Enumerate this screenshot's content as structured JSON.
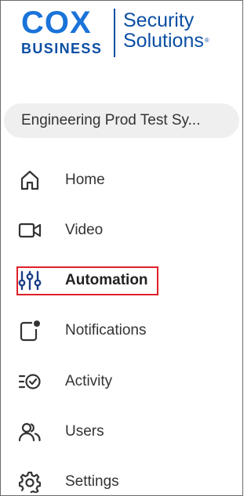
{
  "logo": {
    "brand": "COX",
    "sub": "BUSINESS",
    "product_line1": "Security",
    "product_line2": "Solutions",
    "registered_mark": "®",
    "colors": {
      "primary": "#1a73d9",
      "dark": "#0b4fa3"
    }
  },
  "site_selector": {
    "value": "Engineering Prod Test Sy..."
  },
  "nav": {
    "items": [
      {
        "label": "Home",
        "icon": "home-icon"
      },
      {
        "label": "Video",
        "icon": "video-camera-icon"
      },
      {
        "label": "Automation",
        "icon": "sliders-icon",
        "active": true
      },
      {
        "label": "Notifications",
        "icon": "notification-badge-icon"
      },
      {
        "label": "Activity",
        "icon": "activity-list-check-icon"
      },
      {
        "label": "Users",
        "icon": "users-icon"
      },
      {
        "label": "Settings",
        "icon": "gear-icon"
      }
    ]
  },
  "colors": {
    "highlight": "#e0202a",
    "selector_bg": "#efefef"
  }
}
